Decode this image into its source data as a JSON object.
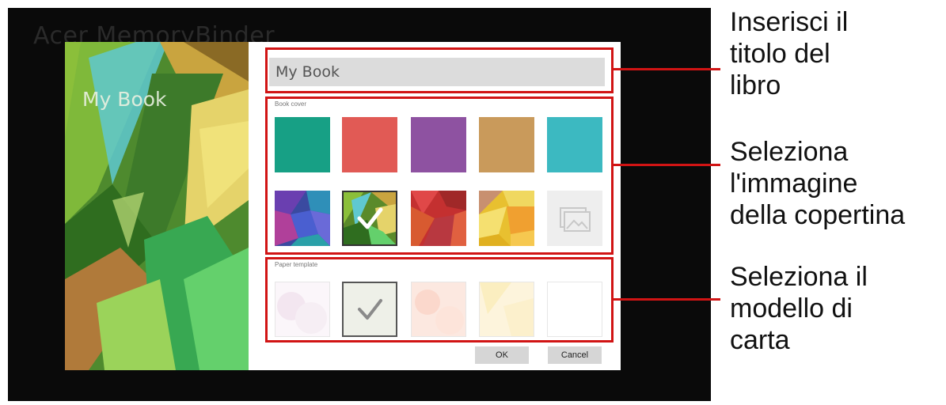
{
  "app": {
    "title": "Acer MemoryBinder"
  },
  "cover_preview": {
    "title": "My Book"
  },
  "dialog": {
    "title_value": "My Book",
    "book_cover_label": "Book cover",
    "paper_template_label": "Paper template",
    "ok_label": "OK",
    "cancel_label": "Cancel",
    "cover_colors": [
      "#17a085",
      "#e15a55",
      "#8e52a1",
      "#c99a5b",
      "#3cb9c1"
    ],
    "selected_cover": "green-pattern",
    "selected_paper": "paper-2"
  },
  "callouts": {
    "title": "Inserisci il\ntitolo del\nlibro",
    "cover": "Seleziona\nl'immagine\ndella copertina",
    "paper": "Seleziona il\nmodello di\ncarta"
  },
  "colors": {
    "annotation": "#d11414"
  }
}
